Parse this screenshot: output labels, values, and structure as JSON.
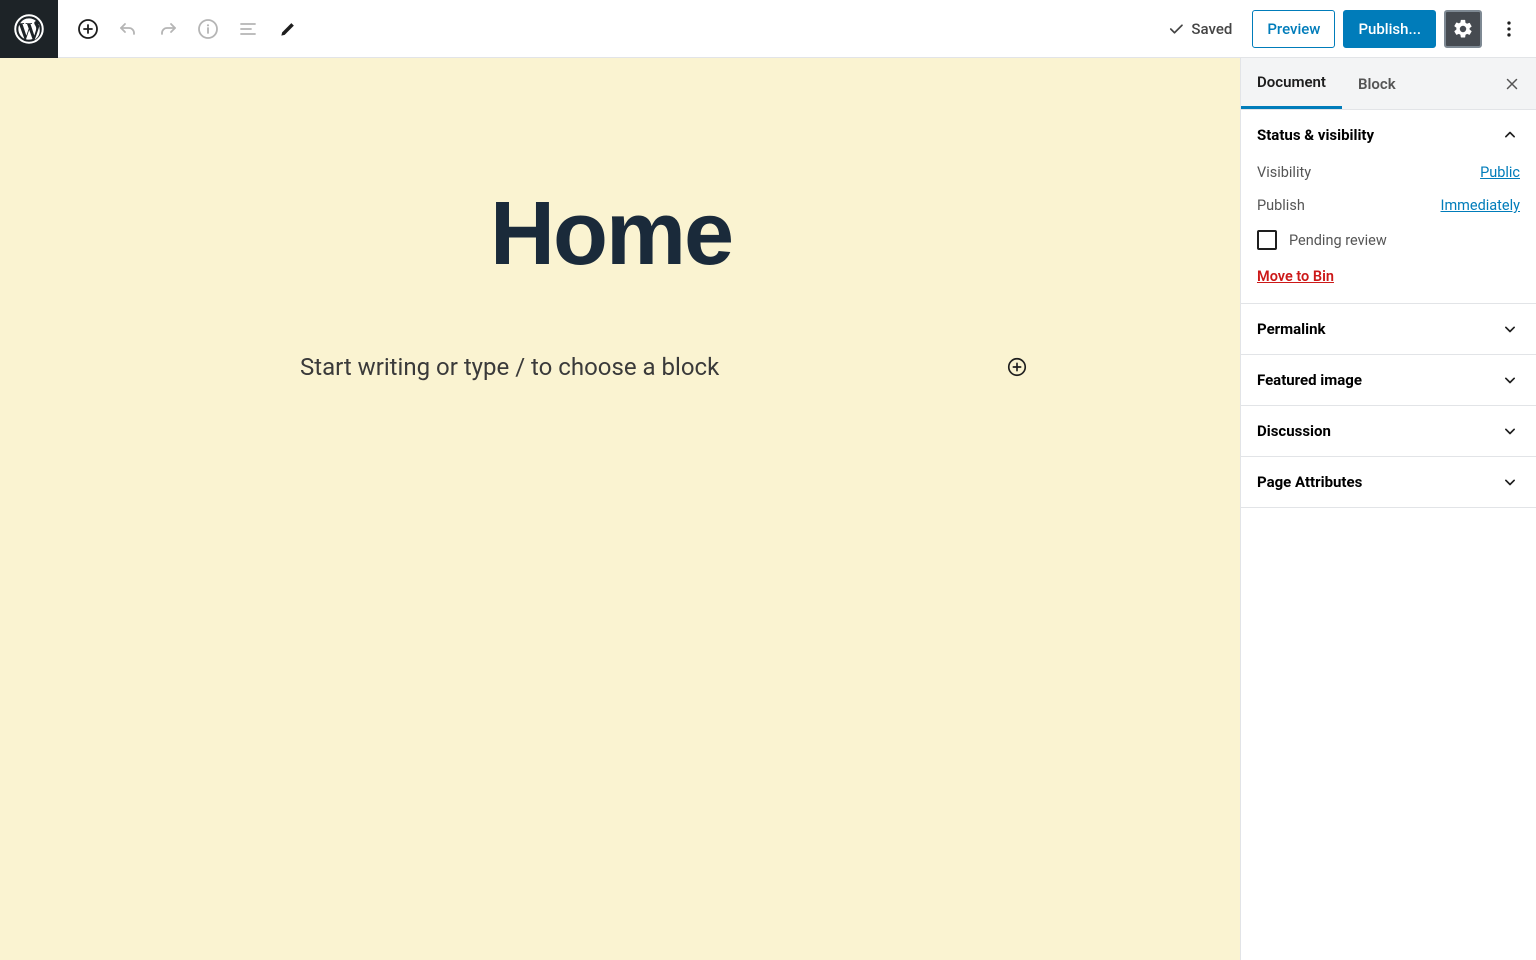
{
  "toolbar": {
    "saved_label": "Saved",
    "preview_label": "Preview",
    "publish_label": "Publish..."
  },
  "editor": {
    "title": "Home",
    "placeholder": "Start writing or type / to choose a block"
  },
  "sidebar": {
    "tabs": {
      "document": "Document",
      "block": "Block"
    },
    "status": {
      "heading": "Status & visibility",
      "visibility_label": "Visibility",
      "visibility_value": "Public",
      "publish_label": "Publish",
      "publish_value": "Immediately",
      "pending_review": "Pending review",
      "move_to_bin": "Move to Bin"
    },
    "panels": {
      "permalink": "Permalink",
      "featured_image": "Featured image",
      "discussion": "Discussion",
      "page_attributes": "Page Attributes"
    }
  }
}
